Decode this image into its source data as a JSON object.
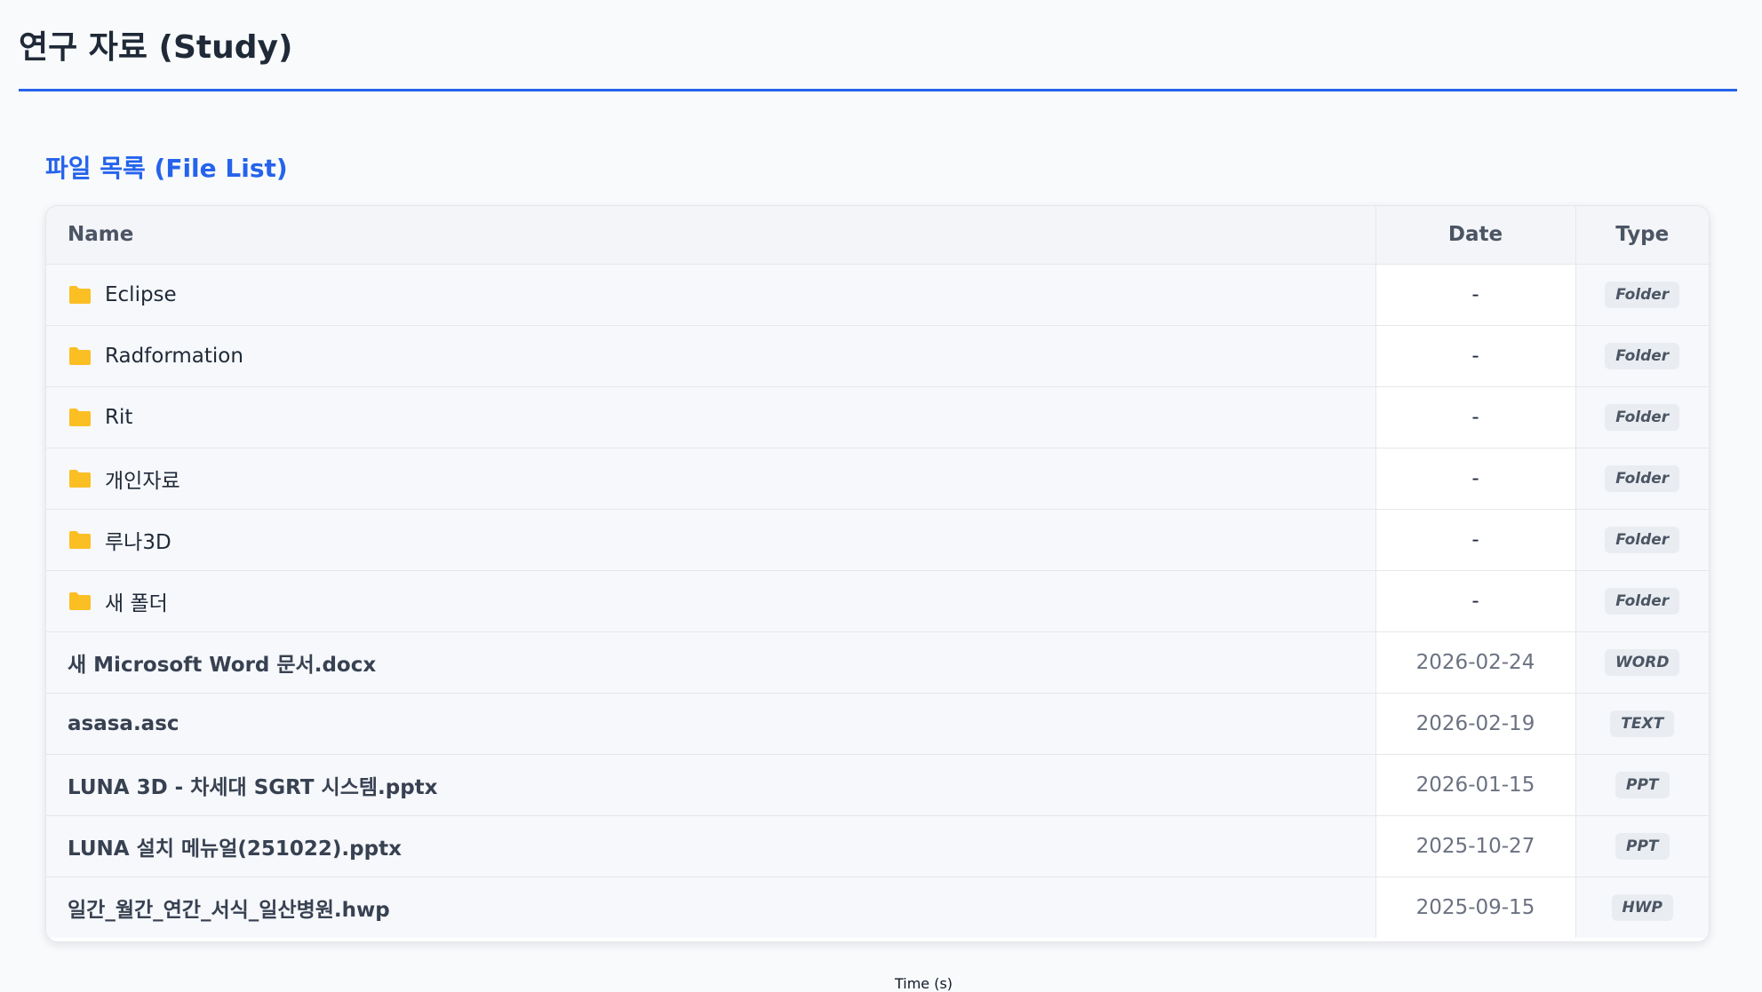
{
  "header": {
    "title": "연구 자료 (Study)"
  },
  "section": {
    "title": "파일 목록 (File List)"
  },
  "table": {
    "columns": {
      "name": "Name",
      "date": "Date",
      "type": "Type"
    },
    "rows": [
      {
        "name": "Eclipse",
        "date": "-",
        "type": "Folder",
        "kind": "folder"
      },
      {
        "name": "Radformation",
        "date": "-",
        "type": "Folder",
        "kind": "folder"
      },
      {
        "name": "Rit",
        "date": "-",
        "type": "Folder",
        "kind": "folder"
      },
      {
        "name": "개인자료",
        "date": "-",
        "type": "Folder",
        "kind": "folder"
      },
      {
        "name": "루나3D",
        "date": "-",
        "type": "Folder",
        "kind": "folder"
      },
      {
        "name": "새 폴더",
        "date": "-",
        "type": "Folder",
        "kind": "folder"
      },
      {
        "name": "새 Microsoft Word 문서.docx",
        "date": "2026-02-24",
        "type": "WORD",
        "kind": "file"
      },
      {
        "name": "asasa.asc",
        "date": "2026-02-19",
        "type": "TEXT",
        "kind": "file"
      },
      {
        "name": "LUNA 3D - 차세대 SGRT 시스템.pptx",
        "date": "2026-01-15",
        "type": "PPT",
        "kind": "file"
      },
      {
        "name": "LUNA 설치 메뉴얼(251022).pptx",
        "date": "2025-10-27",
        "type": "PPT",
        "kind": "file"
      },
      {
        "name": "일간_월간_연간_서식_일산병원.hwp",
        "date": "2025-09-15",
        "type": "HWP",
        "kind": "file"
      }
    ]
  },
  "footer": {
    "axis_label": "Time (s)"
  },
  "colors": {
    "accent": "#2563eb",
    "folder": "#fbbf24"
  },
  "icons": {
    "folder": "folder-icon"
  }
}
